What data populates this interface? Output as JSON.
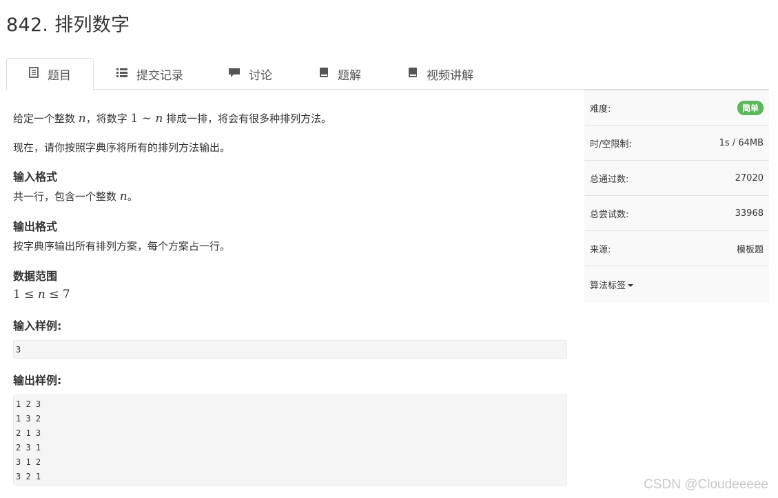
{
  "problem": {
    "title": "842. 排列数字"
  },
  "tabs": [
    {
      "label": "题目",
      "icon": "document-icon",
      "active": true
    },
    {
      "label": "提交记录",
      "icon": "list-icon"
    },
    {
      "label": "讨论",
      "icon": "comment-icon"
    },
    {
      "label": "题解",
      "icon": "book-icon"
    },
    {
      "label": "视频讲解",
      "icon": "book-icon"
    }
  ],
  "description": {
    "line1_a": "给定一个整数 ",
    "line1_var": "n",
    "line1_b": "，将数字 ",
    "line1_math_1": "1",
    "line1_math_tilde": " ∼ ",
    "line1_math_n": "n",
    "line1_c": " 排成一排，将会有很多种排列方法。",
    "line2": "现在，请你按照字典序将所有的排列方法输出。"
  },
  "input_format": {
    "heading": "输入格式",
    "text_a": "共一行，包含一个整数 ",
    "text_var": "n",
    "text_b": "。"
  },
  "output_format": {
    "heading": "输出格式",
    "text": "按字典序输出所有排列方案，每个方案占一行。"
  },
  "data_range": {
    "heading": "数据范围",
    "m1": "1",
    "le1": " ≤ ",
    "mn": "n",
    "le2": " ≤ ",
    "m7": "7"
  },
  "sample_input": {
    "heading": "输入样例:",
    "lines": [
      "3"
    ]
  },
  "sample_output": {
    "heading": "输出样例:",
    "lines": [
      "1 2 3",
      "1 3 2",
      "2 1 3",
      "2 3 1",
      "3 1 2",
      "3 2 1"
    ]
  },
  "sidebar": {
    "difficulty_label": "难度:",
    "difficulty_value": "简单",
    "limit_label": "时/空限制:",
    "limit_value": "1s / 64MB",
    "passed_label": "总通过数:",
    "passed_value": "27020",
    "attempts_label": "总尝试数:",
    "attempts_value": "33968",
    "source_label": "来源:",
    "source_value": "模板题",
    "tags_label": "算法标签"
  },
  "watermark": "CSDN @Cloudeeeee",
  "colors": {
    "badge_green": "#5cb85c",
    "border": "#dddddd",
    "code_bg": "#f5f5f5",
    "sidebar_bg": "#f9f9f9"
  }
}
